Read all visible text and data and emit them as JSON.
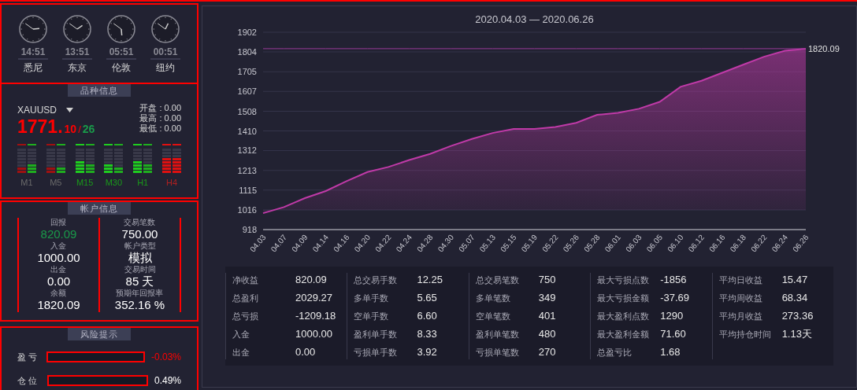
{
  "clocks": [
    {
      "time": "14:51",
      "city": "悉尼"
    },
    {
      "time": "13:51",
      "city": "东京"
    },
    {
      "time": "05:51",
      "city": "伦敦"
    },
    {
      "time": "00:51",
      "city": "纽约"
    }
  ],
  "symbol_panel": {
    "title": "品种信息",
    "symbol": "XAUUSD",
    "price": {
      "main": "1771.",
      "bid": "10",
      "separator": "/",
      "ask": "26"
    },
    "quotes": [
      {
        "text": "开盘 : 0.00"
      },
      {
        "text": "最高 : 0.00"
      },
      {
        "text": "最低 : 0.00"
      }
    ],
    "meters": [
      {
        "label": "M1",
        "color": "#6b6b6b",
        "bars": [
          {
            "level": 0.25,
            "color": "#a01010"
          },
          {
            "level": 0.375,
            "color": "#1fae1f"
          }
        ]
      },
      {
        "label": "M5",
        "color": "#6b6b6b",
        "bars": [
          {
            "level": 0.25,
            "color": "#a01010"
          },
          {
            "level": 0.25,
            "color": "#1fae1f"
          }
        ]
      },
      {
        "label": "M15",
        "color": "#1a9a1a",
        "bars": [
          {
            "level": 0.5,
            "color": "#1fce1f"
          },
          {
            "level": 0.375,
            "color": "#1fae1f"
          }
        ]
      },
      {
        "label": "M30",
        "color": "#1a9a1a",
        "bars": [
          {
            "level": 0.375,
            "color": "#1fce1f"
          },
          {
            "level": 0.25,
            "color": "#1fae1f"
          }
        ]
      },
      {
        "label": "H1",
        "color": "#1a9a1a",
        "bars": [
          {
            "level": 0.5,
            "color": "#1fce1f"
          },
          {
            "level": 0.375,
            "color": "#1fae1f"
          }
        ]
      },
      {
        "label": "H4",
        "color": "#b02020",
        "bars": [
          {
            "level": 0.625,
            "color": "#e01010"
          },
          {
            "level": 0.625,
            "color": "#e01010"
          }
        ]
      }
    ]
  },
  "account_panel": {
    "title": "帐户信息",
    "columns": [
      [
        {
          "label": "回报",
          "value": "820.09",
          "color": "#1a9a4a"
        },
        {
          "label": "入金",
          "value": "1000.00",
          "color": "#ffffff"
        },
        {
          "label": "出金",
          "value": "0.00",
          "color": "#ffffff"
        },
        {
          "label": "余额",
          "value": "1820.09",
          "color": "#ffffff"
        }
      ],
      [
        {
          "label": "交易笔数",
          "value": "750.00",
          "color": "#ffffff"
        },
        {
          "label": "帐户类型",
          "value": "模拟",
          "color": "#ffffff"
        },
        {
          "label": "交易时间",
          "value": "85 天",
          "color": "#ffffff"
        },
        {
          "label": "预期年回报率",
          "value": "352.16 %",
          "color": "#ffffff"
        }
      ]
    ]
  },
  "risk_panel": {
    "title": "风险提示",
    "rows": [
      {
        "label": "盈 亏",
        "level": 0,
        "value": "-0.03%",
        "color": "#ff0000"
      },
      {
        "label": "仓 位",
        "level": 0,
        "value": "0.49%",
        "color": "#ffffff"
      }
    ]
  },
  "chart": {
    "chart_data": {
      "type": "area",
      "title": "2020.04.03 — 2020.06.26",
      "categories": [
        "04.03",
        "04.07",
        "04.09",
        "04.14",
        "04.16",
        "04.20",
        "04.22",
        "04.24",
        "04.28",
        "04.30",
        "05.07",
        "05.13",
        "05.15",
        "05.19",
        "05.22",
        "05.26",
        "05.28",
        "06.01",
        "06.03",
        "06.05",
        "06.10",
        "06.12",
        "06.16",
        "06.18",
        "06.22",
        "06.24",
        "06.26"
      ],
      "series": [
        {
          "color": "#c03aa8",
          "values": [
            1000,
            1030,
            1075,
            1110,
            1160,
            1205,
            1230,
            1265,
            1295,
            1335,
            1370,
            1400,
            1420,
            1420,
            1430,
            1450,
            1490,
            1500,
            1520,
            1555,
            1630,
            1660,
            1700,
            1740,
            1780,
            1810,
            1820
          ]
        },
        {
          "type": "line",
          "color": "#9a3a9a",
          "values": [
            1820,
            1820,
            1820,
            1820,
            1820,
            1820,
            1820,
            1820,
            1820,
            1820,
            1820,
            1820,
            1820,
            1820,
            1820,
            1820,
            1820,
            1820,
            1820,
            1820,
            1820,
            1820,
            1820,
            1820,
            1820,
            1820,
            1820
          ]
        }
      ],
      "ylim": [
        918,
        1902
      ],
      "yticks": [
        918,
        1016,
        1115,
        1213,
        1312,
        1410,
        1508,
        1607,
        1705,
        1804,
        1902
      ],
      "grid": true
    },
    "current_value": "1820.09"
  },
  "stats": [
    [
      {
        "label": "净收益",
        "value": "820.09"
      },
      {
        "label": "总盈利",
        "value": "2029.27"
      },
      {
        "label": "总亏损",
        "value": "-1209.18"
      },
      {
        "label": "入金",
        "value": "1000.00"
      },
      {
        "label": "出金",
        "value": "0.00"
      }
    ],
    [
      {
        "label": "总交易手数",
        "value": "12.25"
      },
      {
        "label": "多单手数",
        "value": "5.65"
      },
      {
        "label": "空单手数",
        "value": "6.60"
      },
      {
        "label": "盈利单手数",
        "value": "8.33"
      },
      {
        "label": "亏损单手数",
        "value": "3.92"
      }
    ],
    [
      {
        "label": "总交易笔数",
        "value": "750"
      },
      {
        "label": "多单笔数",
        "value": "349"
      },
      {
        "label": "空单笔数",
        "value": "401"
      },
      {
        "label": "盈利单笔数",
        "value": "480"
      },
      {
        "label": "亏损单笔数",
        "value": "270"
      }
    ],
    [
      {
        "label": "最大亏损点数",
        "value": "-1856"
      },
      {
        "label": "最大亏损金额",
        "value": "-37.69"
      },
      {
        "label": "最大盈利点数",
        "value": "1290"
      },
      {
        "label": "最大盈利金额",
        "value": "71.60"
      },
      {
        "label": "总盈亏比",
        "value": "1.68"
      }
    ],
    [
      {
        "label": "平均日收益",
        "value": "15.47"
      },
      {
        "label": "平均周收益",
        "value": "68.34"
      },
      {
        "label": "平均月收益",
        "value": "273.36"
      },
      {
        "label": "平均持仓时间",
        "value": "1.13天"
      }
    ]
  ]
}
